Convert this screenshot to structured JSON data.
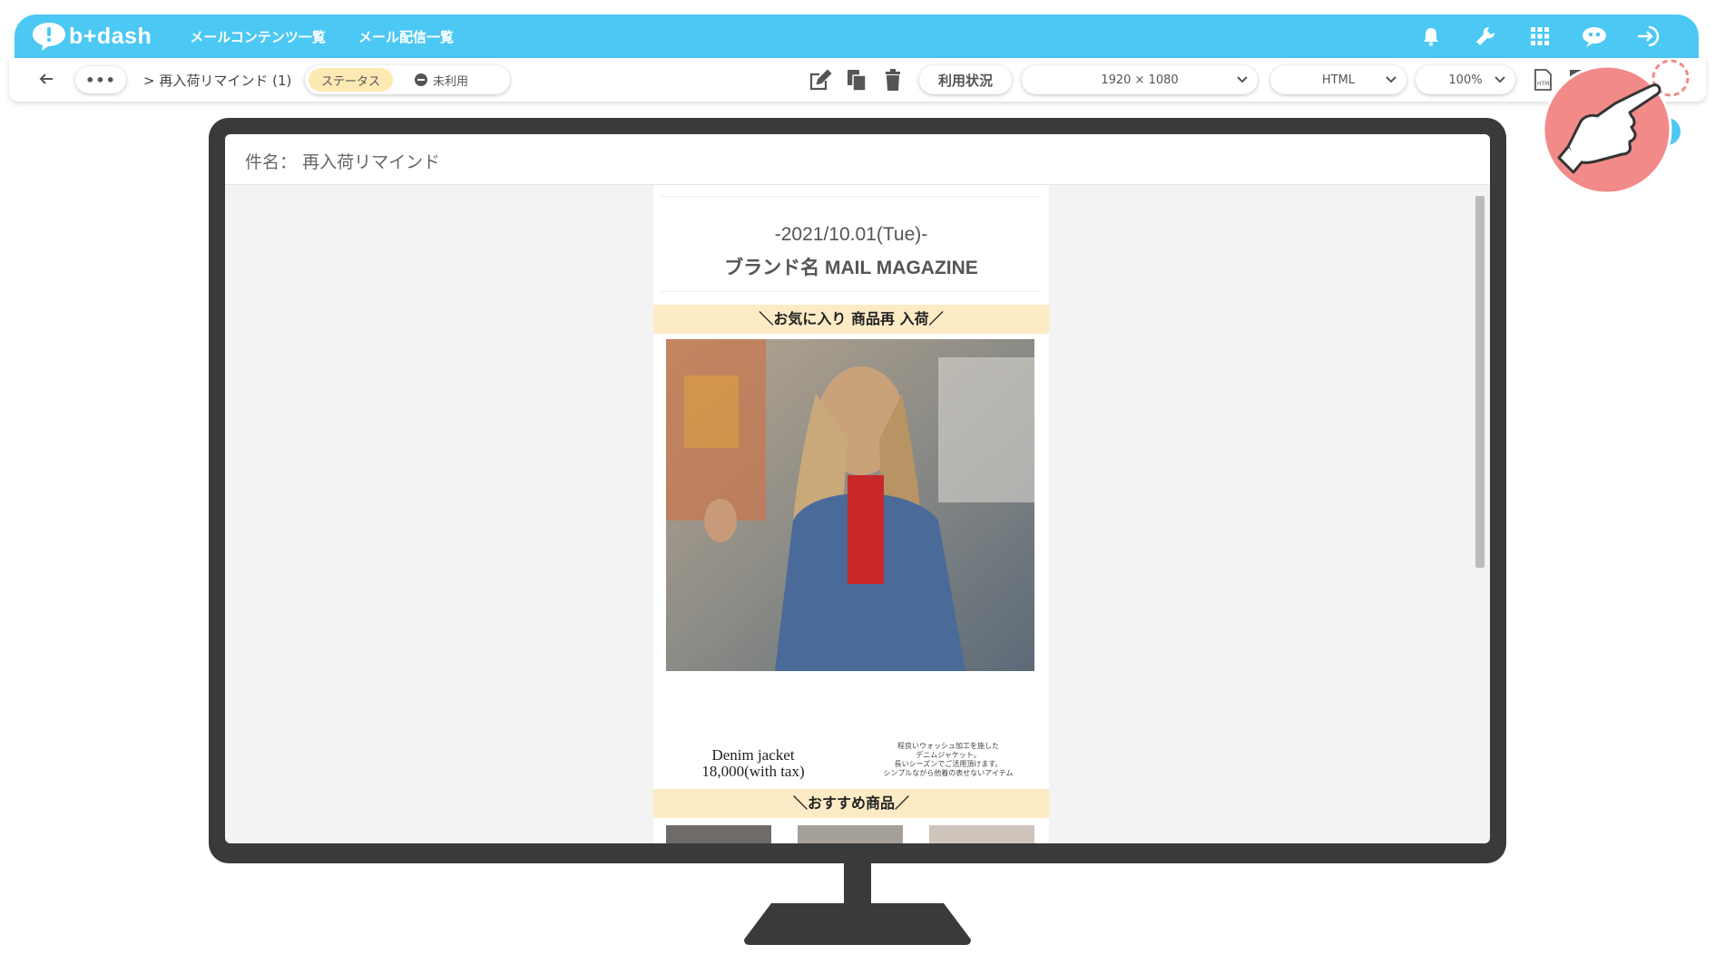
{
  "app": {
    "logo_text": "b+dash"
  },
  "topnav": {
    "links": [
      "メールコンテンツ一覧",
      "メール配信一覧"
    ],
    "icons": [
      "bell-icon",
      "wrench-icon",
      "grid-icon",
      "robot-icon",
      "logout-icon"
    ]
  },
  "toolbar": {
    "more_label": "•••",
    "breadcrumb": "> 再入荷リマインド (1)",
    "status_label": "ステータス",
    "status_value": "未利用",
    "edit_icons": [
      "edit-icon",
      "copy-icon",
      "trash-icon"
    ],
    "usage_label": "利用状況",
    "resolution": "1920 × 1080",
    "format": "HTML",
    "zoom": "100%",
    "right_icons": [
      "html-file-icon",
      "file-icon",
      "file-doc-icon"
    ]
  },
  "preview": {
    "subject_prefix": "件名：",
    "subject": "再入荷リマインド",
    "mail": {
      "date": "-2021/10.01(Tue)-",
      "brand": "ブランド名 MAIL MAGAZINE",
      "section1": "＼お気に入り 商品再 入荷／",
      "product_name": "Denim jacket",
      "product_price": "18,000(with tax)",
      "product_desc": [
        "程良いウォッシュ加工を施した",
        "デニムジャケット。",
        "長いシーズンでご活用頂けます。",
        "シンプルながら他着の表せないアイテム"
      ],
      "section2": "＼おすすめ商品／"
    }
  },
  "colors": {
    "brand_blue": "#4cc8f4",
    "status_bg": "#fde9b3",
    "band_bg": "#fdebc6",
    "monitor": "#3a3a3a",
    "pointer": "#f28a8a"
  }
}
